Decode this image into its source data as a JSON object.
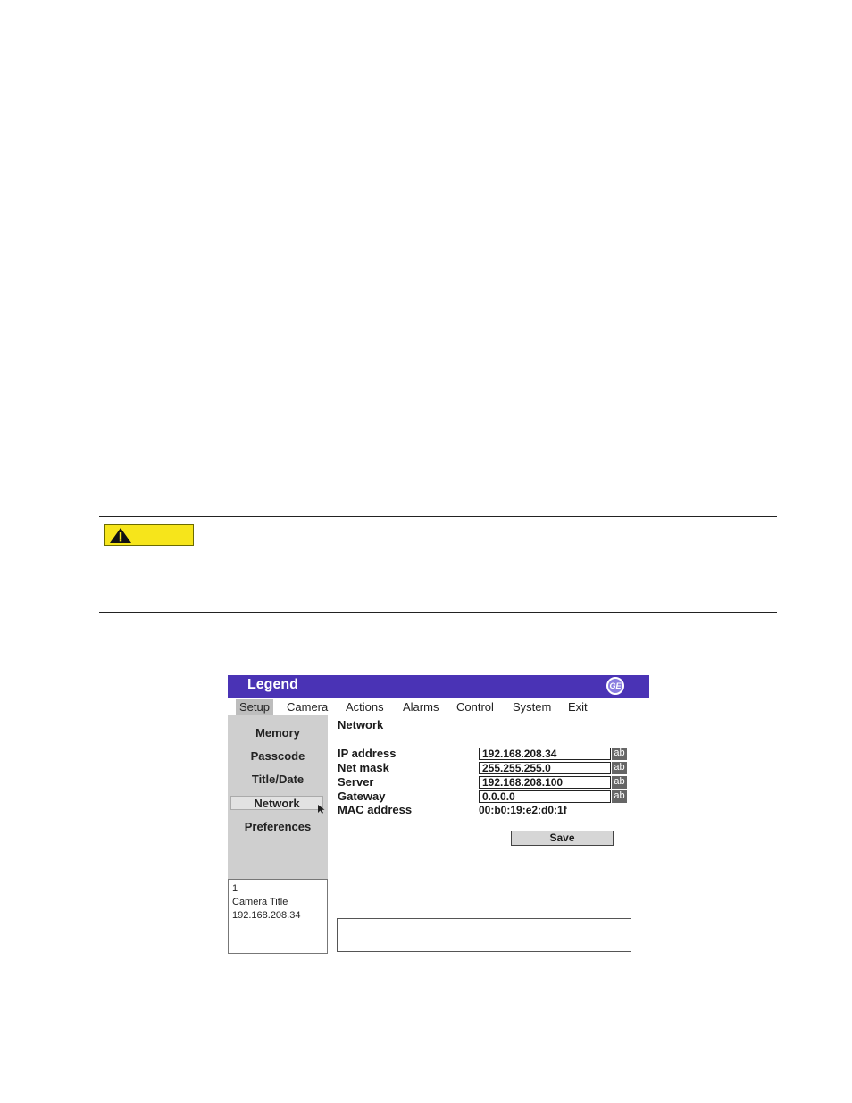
{
  "app": {
    "title": "Legend",
    "logo": "GE",
    "menu": [
      "Setup",
      "Camera",
      "Actions",
      "Alarms",
      "Control",
      "System",
      "Exit"
    ],
    "sidebar": [
      "Memory",
      "Passcode",
      "Title/Date",
      "Network",
      "Preferences"
    ],
    "camera_info": [
      "1",
      "Camera Title",
      "192.168.208.34"
    ],
    "network": {
      "title": "Network",
      "fields": [
        {
          "label": "IP address",
          "value": "192.168.208.34",
          "button": "ab"
        },
        {
          "label": "Net mask",
          "value": "255.255.255.0",
          "button": "ab"
        },
        {
          "label": "Server",
          "value": "192.168.208.100",
          "button": "ab"
        },
        {
          "label": "Gateway",
          "value": "0.0.0.0",
          "button": "ab"
        }
      ],
      "mac_label": "MAC address",
      "mac_value": "00:b0:19:e2:d0:1f",
      "save_label": "Save"
    }
  },
  "colors": {
    "titlebar": "#4a33b5",
    "caution": "#f6e51b"
  },
  "icons": {
    "caution": "warning-triangle-icon",
    "cursor": "mouse-pointer-icon"
  }
}
